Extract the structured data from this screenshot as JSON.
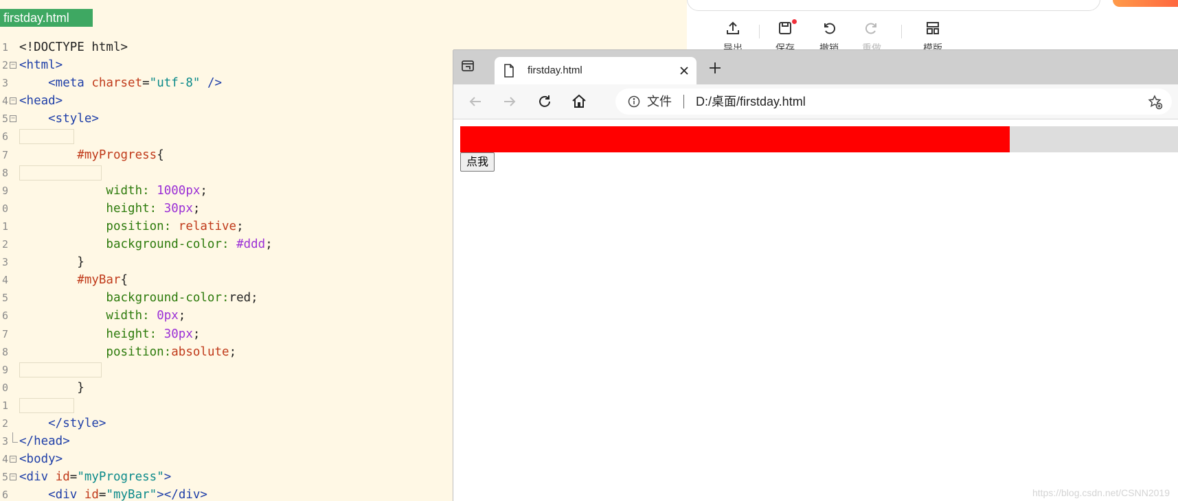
{
  "editor": {
    "tab_label": "firstday.html",
    "lines": [
      {
        "num": "1",
        "fold": "",
        "guides": [],
        "tokens": [
          {
            "t": "<!DOCTYPE html>",
            "c": "plain"
          }
        ]
      },
      {
        "num": "2",
        "fold": "open",
        "guides": [],
        "tokens": [
          {
            "t": "<html>",
            "c": "tag"
          }
        ]
      },
      {
        "num": "3",
        "fold": "",
        "guides": [],
        "tokens": [
          {
            "t": "    <meta ",
            "c": "tag"
          },
          {
            "t": "charset",
            "c": "attr"
          },
          {
            "t": "=",
            "c": "plain"
          },
          {
            "t": "\"utf-8\"",
            "c": "str"
          },
          {
            "t": " />",
            "c": "tag"
          }
        ]
      },
      {
        "num": "4",
        "fold": "open",
        "guides": [],
        "tokens": [
          {
            "t": "<head>",
            "c": "tag"
          }
        ]
      },
      {
        "num": "5",
        "fold": "open",
        "guides": [],
        "tokens": [
          {
            "t": "    <style>",
            "c": "tag"
          }
        ]
      },
      {
        "num": "6",
        "fold": "",
        "guides": [
          80
        ],
        "tokens": []
      },
      {
        "num": "7",
        "fold": "",
        "guides": [],
        "tokens": [
          {
            "t": "        #myProgress",
            "c": "sel"
          },
          {
            "t": "{",
            "c": "plain"
          }
        ]
      },
      {
        "num": "8",
        "fold": "",
        "guides": [
          120
        ],
        "tokens": []
      },
      {
        "num": "9",
        "fold": "",
        "guides": [],
        "tokens": [
          {
            "t": "            width: ",
            "c": "prop"
          },
          {
            "t": "1000px",
            "c": "num"
          },
          {
            "t": ";",
            "c": "plain"
          }
        ]
      },
      {
        "num": "0",
        "fold": "",
        "guides": [],
        "tokens": [
          {
            "t": "            height: ",
            "c": "prop"
          },
          {
            "t": "30px",
            "c": "num"
          },
          {
            "t": ";",
            "c": "plain"
          }
        ]
      },
      {
        "num": "1",
        "fold": "",
        "guides": [],
        "tokens": [
          {
            "t": "            position: ",
            "c": "prop"
          },
          {
            "t": "relative",
            "c": "val"
          },
          {
            "t": ";",
            "c": "plain"
          }
        ]
      },
      {
        "num": "2",
        "fold": "",
        "guides": [],
        "tokens": [
          {
            "t": "            background-color: ",
            "c": "prop"
          },
          {
            "t": "#ddd",
            "c": "num"
          },
          {
            "t": ";",
            "c": "plain"
          }
        ]
      },
      {
        "num": "3",
        "fold": "",
        "guides": [],
        "tokens": [
          {
            "t": "        }",
            "c": "plain"
          }
        ]
      },
      {
        "num": "4",
        "fold": "",
        "guides": [],
        "tokens": [
          {
            "t": "        #myBar",
            "c": "sel"
          },
          {
            "t": "{",
            "c": "plain"
          }
        ]
      },
      {
        "num": "5",
        "fold": "",
        "guides": [],
        "tokens": [
          {
            "t": "            background-color:",
            "c": "prop"
          },
          {
            "t": "red;",
            "c": "plain"
          }
        ]
      },
      {
        "num": "6",
        "fold": "",
        "guides": [],
        "tokens": [
          {
            "t": "            width: ",
            "c": "prop"
          },
          {
            "t": "0px",
            "c": "num"
          },
          {
            "t": ";",
            "c": "plain"
          }
        ]
      },
      {
        "num": "7",
        "fold": "",
        "guides": [],
        "tokens": [
          {
            "t": "            height: ",
            "c": "prop"
          },
          {
            "t": "30px",
            "c": "num"
          },
          {
            "t": ";",
            "c": "plain"
          }
        ]
      },
      {
        "num": "8",
        "fold": "",
        "guides": [],
        "tokens": [
          {
            "t": "            position:",
            "c": "prop"
          },
          {
            "t": "absolute",
            "c": "val"
          },
          {
            "t": ";",
            "c": "plain"
          }
        ]
      },
      {
        "num": "9",
        "fold": "",
        "guides": [
          120
        ],
        "tokens": []
      },
      {
        "num": "0",
        "fold": "",
        "guides": [],
        "tokens": [
          {
            "t": "        }",
            "c": "plain"
          }
        ]
      },
      {
        "num": "1",
        "fold": "",
        "guides": [
          80
        ],
        "tokens": []
      },
      {
        "num": "2",
        "fold": "",
        "guides": [],
        "tokens": [
          {
            "t": "    </style>",
            "c": "tag"
          }
        ]
      },
      {
        "num": "3",
        "fold": "end",
        "guides": [],
        "tokens": [
          {
            "t": "</head>",
            "c": "tag"
          }
        ]
      },
      {
        "num": "4",
        "fold": "open",
        "guides": [],
        "tokens": [
          {
            "t": "<body>",
            "c": "tag"
          }
        ]
      },
      {
        "num": "5",
        "fold": "open",
        "guides": [],
        "tokens": [
          {
            "t": "<div ",
            "c": "tag"
          },
          {
            "t": "id",
            "c": "attr"
          },
          {
            "t": "=",
            "c": "plain"
          },
          {
            "t": "\"myProgress\"",
            "c": "str"
          },
          {
            "t": ">",
            "c": "tag"
          }
        ]
      },
      {
        "num": "6",
        "fold": "",
        "guides": [],
        "tokens": [
          {
            "t": "    <div ",
            "c": "tag"
          },
          {
            "t": "id",
            "c": "attr"
          },
          {
            "t": "=",
            "c": "plain"
          },
          {
            "t": "\"myBar\"",
            "c": "str"
          },
          {
            "t": "></div>",
            "c": "tag"
          }
        ]
      }
    ]
  },
  "bg_toolbar": {
    "tools": [
      {
        "label": "导出",
        "icon": "export-icon",
        "disabled": false
      },
      {
        "label": "保存",
        "icon": "save-icon",
        "disabled": false,
        "badge": true
      },
      {
        "label": "撤销",
        "icon": "undo-icon",
        "disabled": false
      },
      {
        "label": "重做",
        "icon": "redo-icon",
        "disabled": true
      },
      {
        "label": "模版",
        "icon": "template-icon",
        "disabled": false
      }
    ]
  },
  "browser": {
    "tab_title": "firstday.html",
    "address_scheme": "文件",
    "address_url": "D:/桌面/firstday.html",
    "page": {
      "progress_fill_fraction": 0.727,
      "bar_color": "#ff0000",
      "track_color": "#dddddd",
      "button_label": "点我"
    }
  },
  "watermark": "https://blog.csdn.net/CSNN2019"
}
